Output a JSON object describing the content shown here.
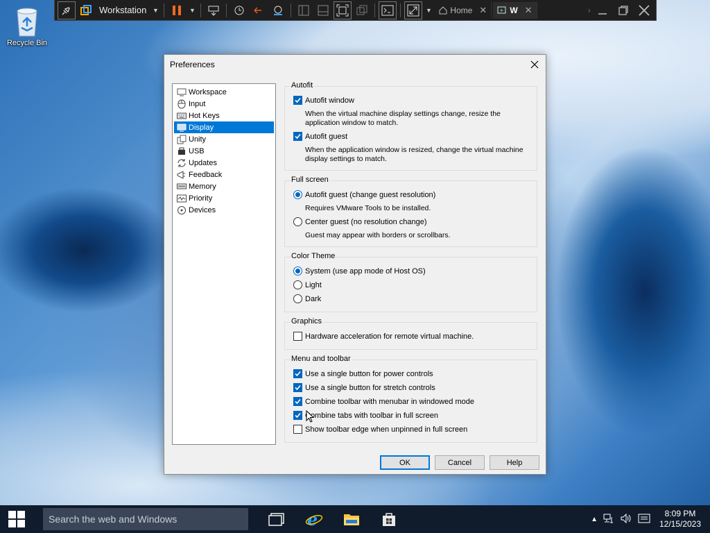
{
  "desktop": {
    "recycle_bin_label": "Recycle Bin"
  },
  "vm_toolbar": {
    "title": "Workstation",
    "tabs": [
      {
        "label": "Home"
      },
      {
        "label": "W"
      }
    ]
  },
  "dialog": {
    "title": "Preferences",
    "nav": [
      {
        "label": "Workspace",
        "icon": "workspace-icon",
        "selected": false
      },
      {
        "label": "Input",
        "icon": "mouse-icon",
        "selected": false
      },
      {
        "label": "Hot Keys",
        "icon": "keyboard-icon",
        "selected": false
      },
      {
        "label": "Display",
        "icon": "monitor-icon",
        "selected": true
      },
      {
        "label": "Unity",
        "icon": "unity-icon",
        "selected": false
      },
      {
        "label": "USB",
        "icon": "usb-icon",
        "selected": false
      },
      {
        "label": "Updates",
        "icon": "updates-icon",
        "selected": false
      },
      {
        "label": "Feedback",
        "icon": "feedback-icon",
        "selected": false
      },
      {
        "label": "Memory",
        "icon": "memory-icon",
        "selected": false
      },
      {
        "label": "Priority",
        "icon": "priority-icon",
        "selected": false
      },
      {
        "label": "Devices",
        "icon": "devices-icon",
        "selected": false
      }
    ],
    "autofit": {
      "title": "Autofit",
      "autofit_window": {
        "label": "Autofit window",
        "checked": true,
        "desc": "When the virtual machine display settings change, resize the application window to match."
      },
      "autofit_guest": {
        "label": "Autofit guest",
        "checked": true,
        "desc": "When the application window is resized, change the virtual machine display settings to match."
      }
    },
    "full_screen": {
      "title": "Full screen",
      "option_autofit": {
        "label": "Autofit guest (change guest resolution)",
        "selected": true,
        "desc": "Requires VMware Tools to be installed."
      },
      "option_center": {
        "label": "Center guest (no resolution change)",
        "selected": false,
        "desc": "Guest may appear with borders or scrollbars."
      }
    },
    "color_theme": {
      "title": "Color Theme",
      "options": [
        {
          "label": "System (use app mode of Host OS)",
          "selected": true
        },
        {
          "label": "Light",
          "selected": false
        },
        {
          "label": "Dark",
          "selected": false
        }
      ]
    },
    "graphics": {
      "title": "Graphics",
      "hw_accel": {
        "label": "Hardware acceleration for remote virtual machine.",
        "checked": false
      }
    },
    "menu_toolbar": {
      "title": "Menu and toolbar",
      "options": [
        {
          "label": "Use a single button for power controls",
          "checked": true
        },
        {
          "label": "Use a single button for stretch controls",
          "checked": true
        },
        {
          "label": "Combine toolbar with menubar in windowed mode",
          "checked": true
        },
        {
          "label": "Combine tabs with toolbar in full screen",
          "checked": true
        },
        {
          "label": "Show toolbar edge when unpinned in full screen",
          "checked": false
        }
      ]
    },
    "buttons": {
      "ok": "OK",
      "cancel": "Cancel",
      "help": "Help"
    }
  },
  "taskbar": {
    "search_placeholder": "Search the web and Windows",
    "time": "8:09 PM",
    "date": "12/15/2023"
  },
  "colors": {
    "accent": "#0078d7",
    "taskbar": "#101c2c",
    "toolbar": "#1f1f1f"
  }
}
